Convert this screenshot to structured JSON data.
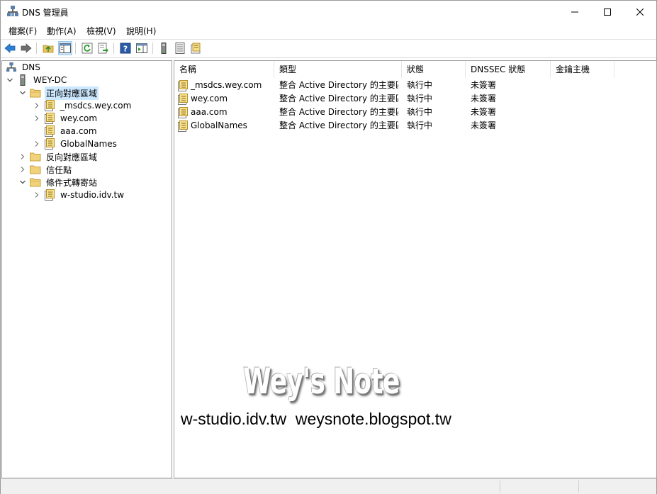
{
  "window": {
    "title": "DNS 管理員"
  },
  "menubar": {
    "items": [
      "檔案(F)",
      "動作(A)",
      "檢視(V)",
      "說明(H)"
    ]
  },
  "toolbar": {
    "icons": [
      "back-icon",
      "forward-icon",
      "up-folder-icon",
      "show-hide-tree-icon",
      "refresh-icon",
      "export-list-icon",
      "help-icon",
      "properties-view-icon",
      "server-icon",
      "zone-list-icon",
      "new-zone-icon"
    ]
  },
  "tree": {
    "root": "DNS",
    "server": "WEY-DC",
    "forward_zones": "正向對應區域",
    "zones": [
      "_msdcs.wey.com",
      "wey.com",
      "aaa.com",
      "GlobalNames"
    ],
    "reverse_zones": "反向對應區域",
    "trust_points": "信任點",
    "conditional_forwarders": "條件式轉寄站",
    "forwarder_items": [
      "w-studio.idv.tw"
    ]
  },
  "list": {
    "columns": [
      "名稱",
      "類型",
      "狀態",
      "DNSSEC 狀態",
      "金鑰主機"
    ],
    "rows": [
      {
        "name": "_msdcs.wey.com",
        "type": "整合 Active Directory 的主要區",
        "status": "執行中",
        "dnssec": "未簽署",
        "key_master": ""
      },
      {
        "name": "wey.com",
        "type": "整合 Active Directory 的主要區",
        "status": "執行中",
        "dnssec": "未簽署",
        "key_master": ""
      },
      {
        "name": "aaa.com",
        "type": "整合 Active Directory 的主要區",
        "status": "執行中",
        "dnssec": "未簽署",
        "key_master": ""
      },
      {
        "name": "GlobalNames",
        "type": "整合 Active Directory 的主要區",
        "status": "執行中",
        "dnssec": "未簽署",
        "key_master": ""
      }
    ]
  },
  "watermark": {
    "title": "Wey's Note",
    "urls": "w-studio.idv.tw  weysnote.blogspot.tw"
  },
  "colors": {
    "selection": "#cce8ff",
    "toolbar_pressed": "#cce4f7",
    "folder": "#e8c25a"
  }
}
